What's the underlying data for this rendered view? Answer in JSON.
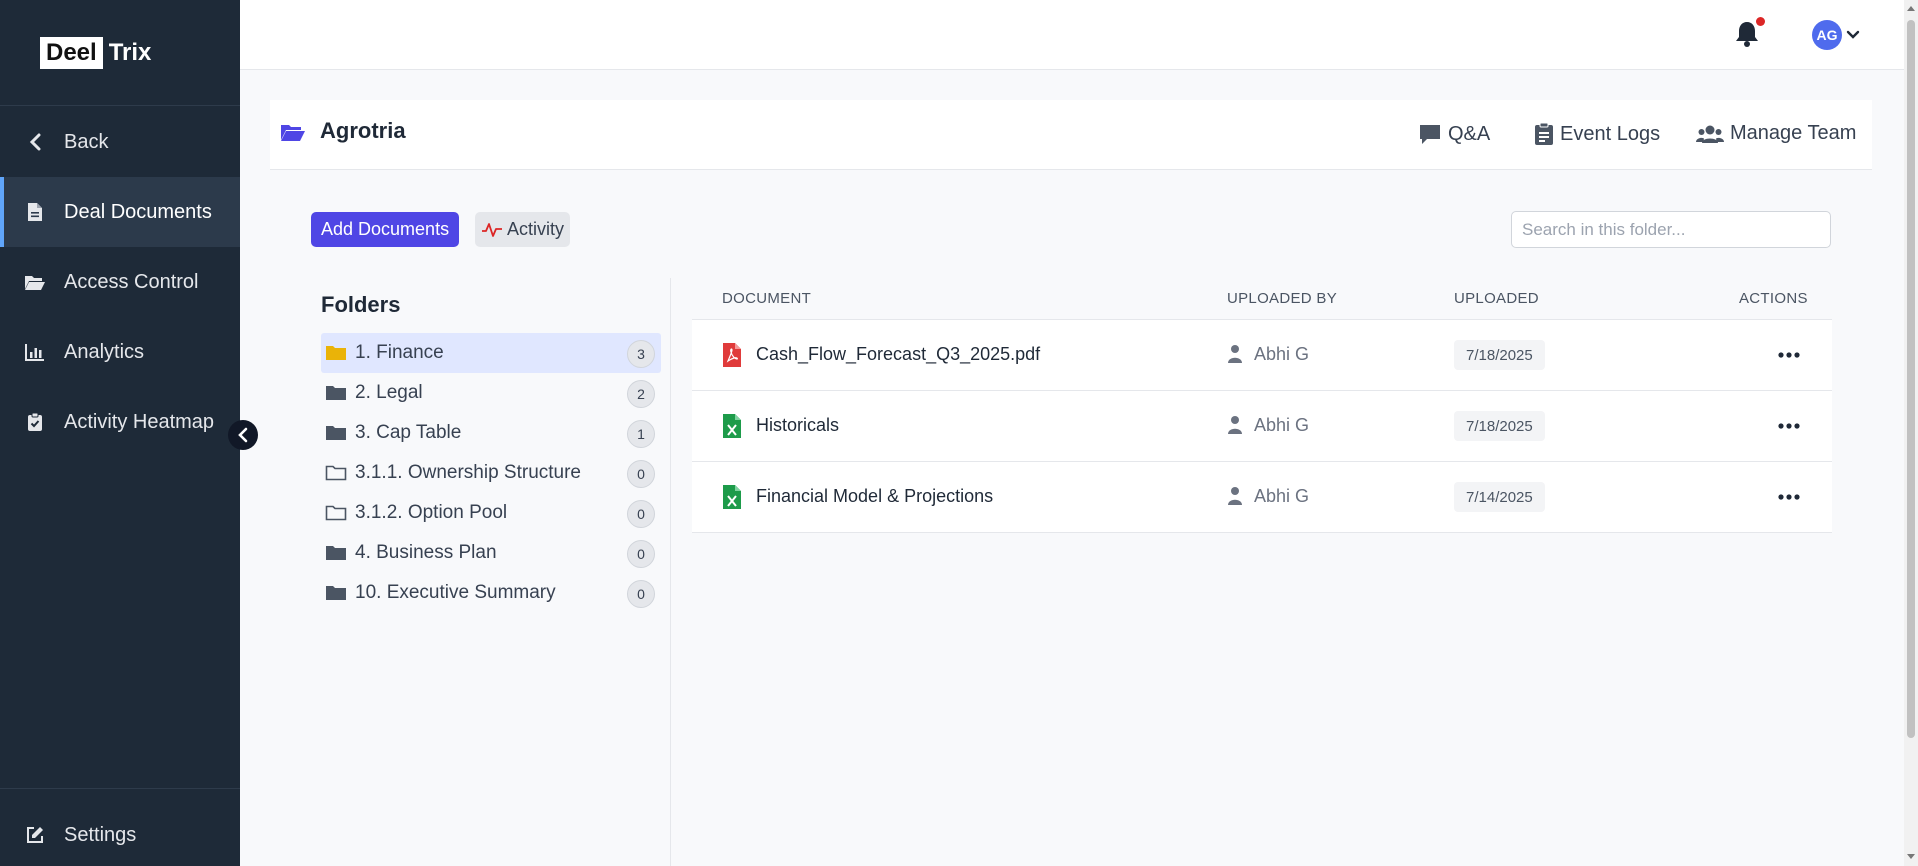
{
  "brand": {
    "logo_box": "Deel",
    "logo_rest": "Trix"
  },
  "sidebar": {
    "items": [
      {
        "label": "Back",
        "icon": "chevron-left-icon"
      },
      {
        "label": "Deal Documents",
        "icon": "document-icon"
      },
      {
        "label": "Access Control",
        "icon": "folder-open-icon"
      },
      {
        "label": "Analytics",
        "icon": "bar-chart-icon"
      },
      {
        "label": "Activity Heatmap",
        "icon": "clipboard-check-icon"
      }
    ],
    "settings_label": "Settings",
    "active_item": "Deal Documents"
  },
  "topbar": {
    "avatar_initials": "AG"
  },
  "project": {
    "title": "Agrotria",
    "actions": [
      {
        "label": "Q&A",
        "icon": "chat-bubble-icon"
      },
      {
        "label": "Event Logs",
        "icon": "clipboard-list-icon"
      },
      {
        "label": "Manage Team",
        "icon": "users-icon"
      }
    ]
  },
  "toolbar": {
    "add_label": "Add Documents",
    "activity_label": "Activity",
    "search_placeholder": "Search in this folder..."
  },
  "folders": {
    "title": "Folders",
    "items": [
      {
        "label": "1. Finance",
        "count": "3",
        "style": "solid"
      },
      {
        "label": "2. Legal",
        "count": "2",
        "style": "solid"
      },
      {
        "label": "3. Cap Table",
        "count": "1",
        "style": "solid"
      },
      {
        "label": "3.1.1. Ownership Structure",
        "count": "0",
        "style": "outline"
      },
      {
        "label": "3.1.2. Option Pool",
        "count": "0",
        "style": "outline"
      },
      {
        "label": "4. Business Plan",
        "count": "0",
        "style": "solid"
      },
      {
        "label": "10. Executive Summary",
        "count": "0",
        "style": "solid"
      }
    ]
  },
  "documents": {
    "columns": [
      "Document",
      "Uploaded By",
      "Uploaded",
      "Actions"
    ],
    "rows": [
      {
        "name": "Cash_Flow_Forecast_Q3_2025.pdf",
        "type": "pdf",
        "uploaded_by": "Abhi G",
        "uploaded": "7/18/2025"
      },
      {
        "name": "Historicals",
        "type": "excel",
        "uploaded_by": "Abhi G",
        "uploaded": "7/18/2025"
      },
      {
        "name": "Financial Model & Projections",
        "type": "excel",
        "uploaded_by": "Abhi G",
        "uploaded": "7/14/2025"
      }
    ]
  },
  "colors": {
    "sidebar_bg": "#1e2a38",
    "accent": "#4f46e5",
    "pdf": "#e03b3b",
    "excel": "#1d9b4a",
    "active_folder_bg": "#e0e7ff"
  }
}
